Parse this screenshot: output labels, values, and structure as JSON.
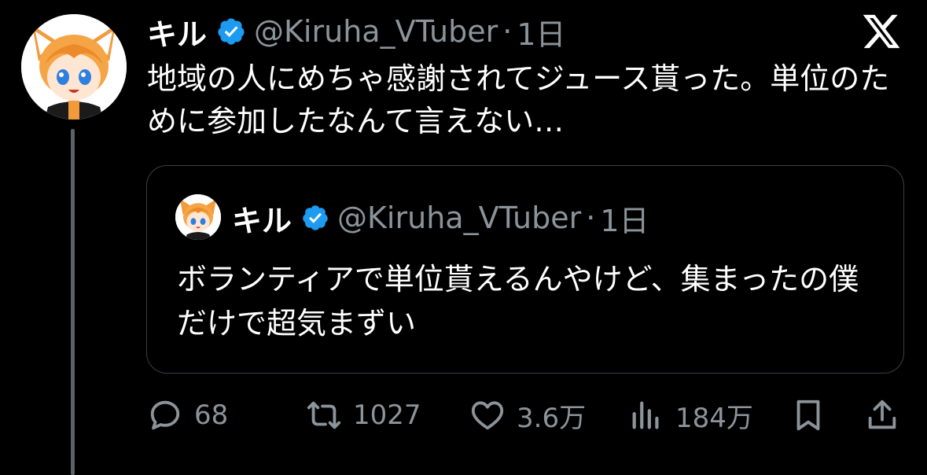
{
  "tweet": {
    "author_name": "キル",
    "handle": "@Kiruha_VTuber",
    "separator": "·",
    "time": "1日",
    "text": "地域の人にめちゃ感謝されてジュース貰った。単位のために参加したなんて言えない…"
  },
  "quote": {
    "author_name": "キル",
    "handle": "@Kiruha_VTuber",
    "separator": "·",
    "time": "1日",
    "text": "ボランティアで単位貰えるんやけど、集まったの僕だけで超気まずい"
  },
  "actions": {
    "replies": "68",
    "retweets": "1027",
    "likes": "3.6万",
    "views": "184万"
  },
  "colors": {
    "background": "#000000",
    "text": "#ffffff",
    "muted": "#8b949a",
    "verified_blue": "#1d9bf0",
    "avatar_hair": "#f29a3c"
  },
  "icons": [
    "verified-badge-icon",
    "x-logo-icon",
    "reply-icon",
    "retweet-icon",
    "like-icon",
    "views-icon",
    "bookmark-icon",
    "share-icon"
  ]
}
